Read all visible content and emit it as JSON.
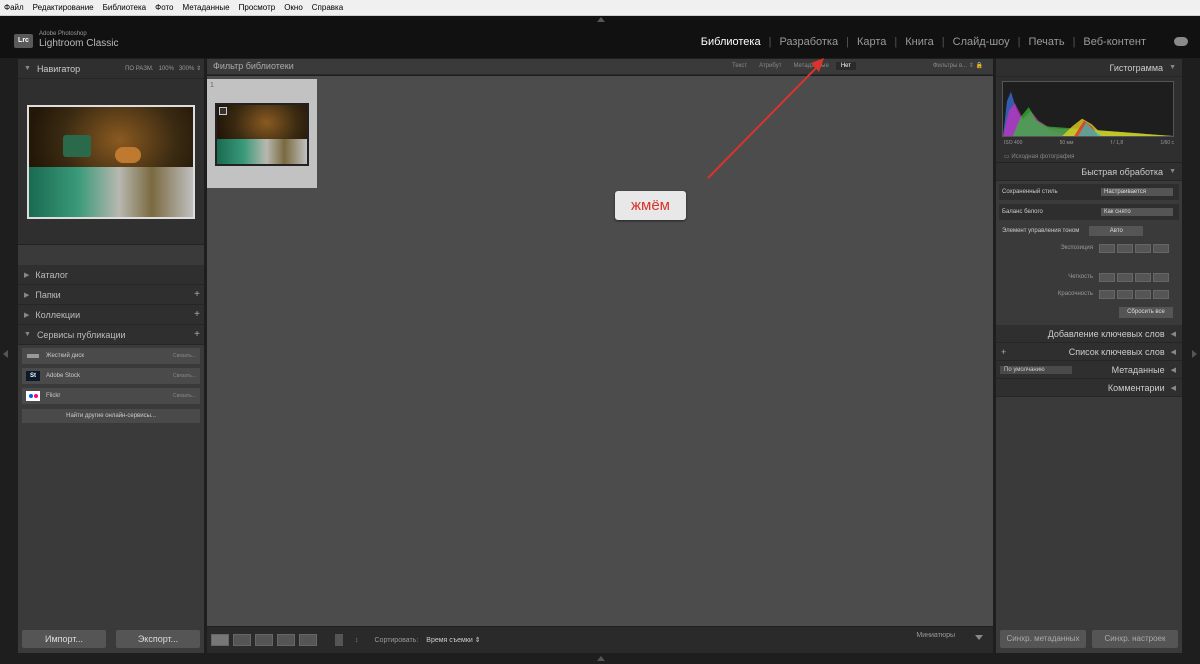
{
  "menu": [
    "Файл",
    "Редактирование",
    "Библиотека",
    "Фото",
    "Метаданные",
    "Просмотр",
    "Окно",
    "Справка"
  ],
  "brand": {
    "logo": "Lrc",
    "line1": "Adobe Photoshop",
    "line2": "Lightroom Classic"
  },
  "modules": [
    {
      "label": "Библиотека",
      "active": true
    },
    {
      "label": "Разработка",
      "active": false
    },
    {
      "label": "Карта",
      "active": false
    },
    {
      "label": "Книга",
      "active": false
    },
    {
      "label": "Слайд-шоу",
      "active": false
    },
    {
      "label": "Печать",
      "active": false
    },
    {
      "label": "Веб-контент",
      "active": false
    }
  ],
  "left": {
    "navigator": {
      "title": "Навигатор",
      "z1": "ПО РАЗМ.",
      "z2": "100%",
      "z3": "300%"
    },
    "catalog": "Каталог",
    "folders": "Папки",
    "collections": "Коллекции",
    "publish": "Сервисы публикации",
    "services": [
      {
        "name": "Жесткий диск",
        "action": "Связать..."
      },
      {
        "name": "Adobe Stock",
        "action": "Связать..."
      },
      {
        "name": "Flickr",
        "action": "Связать..."
      }
    ],
    "find_more": "Найти другие онлайн-сервисы...",
    "import": "Импорт...",
    "export": "Экспорт..."
  },
  "filter": {
    "title": "Фильтр библиотеки",
    "tabs": [
      "Текст",
      "Атрибут",
      "Метаданные",
      "Нет"
    ],
    "active_tab": "Нет",
    "preset": "Фильтры в..."
  },
  "grid": {
    "cell_index": "1"
  },
  "annotation": "жмём",
  "toolbar": {
    "sort_label": "Сортировать:",
    "sort_value": "Время съемки",
    "thumbs_label": "Миниатюры"
  },
  "right": {
    "histogram": "Гистограмма",
    "iso": "ISO 400",
    "focal": "50 мм",
    "aperture": "f / 1,8",
    "shutter": "1/60 с",
    "original": "Исходная фотография",
    "quick": "Быстрая обработка",
    "saved_preset_label": "Сохраненный стиль",
    "saved_preset_value": "Настраивается",
    "wb_label": "Баланс белого",
    "wb_value": "Как снято",
    "tone_label": "Элемент управления тоном",
    "auto": "Авто",
    "exposure": "Экспозиция",
    "clarity": "Четкость",
    "vibrance": "Красочность",
    "reset": "Сбросить все",
    "keywording": "Добавление ключевых слов",
    "keyword_list": "Список ключевых слов",
    "metadata_preset": "По умолчанию",
    "metadata": "Метаданные",
    "comments": "Комментарии",
    "sync_meta": "Синхр. метаданных",
    "sync_settings": "Синхр. настроек"
  }
}
